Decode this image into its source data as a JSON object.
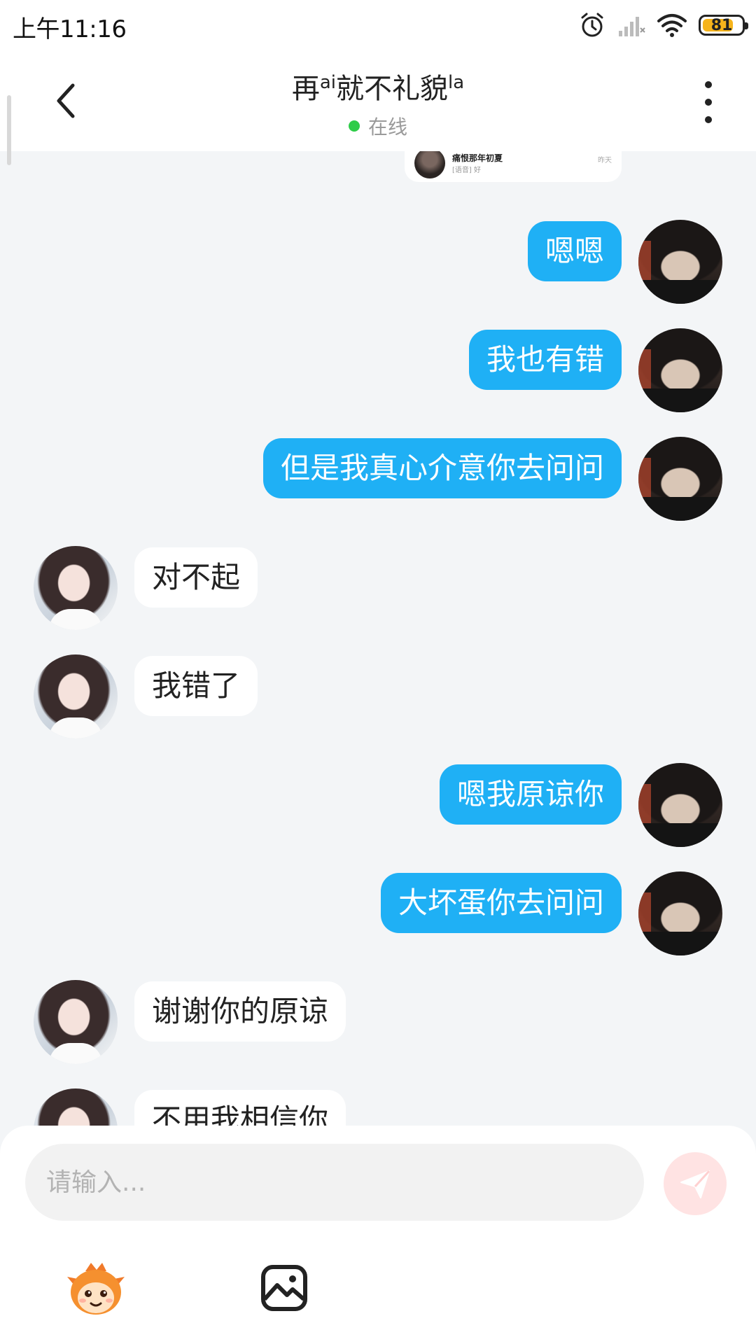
{
  "status_bar": {
    "time": "上午11:16",
    "battery_level": 81,
    "battery_text": "81",
    "battery_color": "#f6b41b"
  },
  "header": {
    "title_parts": [
      "再",
      "ai",
      "就不礼貌",
      "la"
    ],
    "status": "在线",
    "status_color": "#2ecc48"
  },
  "quote_card": {
    "name": "痛恨那年初夏",
    "preview": "[语音] 好",
    "time": "昨天"
  },
  "colors": {
    "sent_bubble": "#1fb0f5",
    "received_bubble": "#ffffff",
    "background": "#f3f5f7",
    "send_button": "#ffe3e3"
  },
  "messages": [
    {
      "side": "right",
      "text": "嗯嗯",
      "avatar": "male-avatar"
    },
    {
      "side": "right",
      "text": "我也有错",
      "avatar": "male-avatar"
    },
    {
      "side": "right",
      "text": "但是我真心介意你去问问",
      "avatar": "male-avatar"
    },
    {
      "side": "left",
      "text": "对不起",
      "avatar": "female-avatar"
    },
    {
      "side": "left",
      "text": "我错了",
      "avatar": "female-avatar"
    },
    {
      "side": "right",
      "text": "嗯我原谅你",
      "avatar": "male-avatar"
    },
    {
      "side": "right",
      "text": "大坏蛋你去问问",
      "avatar": "male-avatar"
    },
    {
      "side": "left",
      "text": "谢谢你的原谅",
      "avatar": "female-avatar"
    },
    {
      "side": "left",
      "text": "不用我相信你",
      "avatar": "female-avatar"
    }
  ],
  "input": {
    "placeholder": "请输入...",
    "value": ""
  },
  "toolbar": {
    "icons": [
      "send-icon",
      "emoji-icon",
      "image-icon"
    ]
  }
}
